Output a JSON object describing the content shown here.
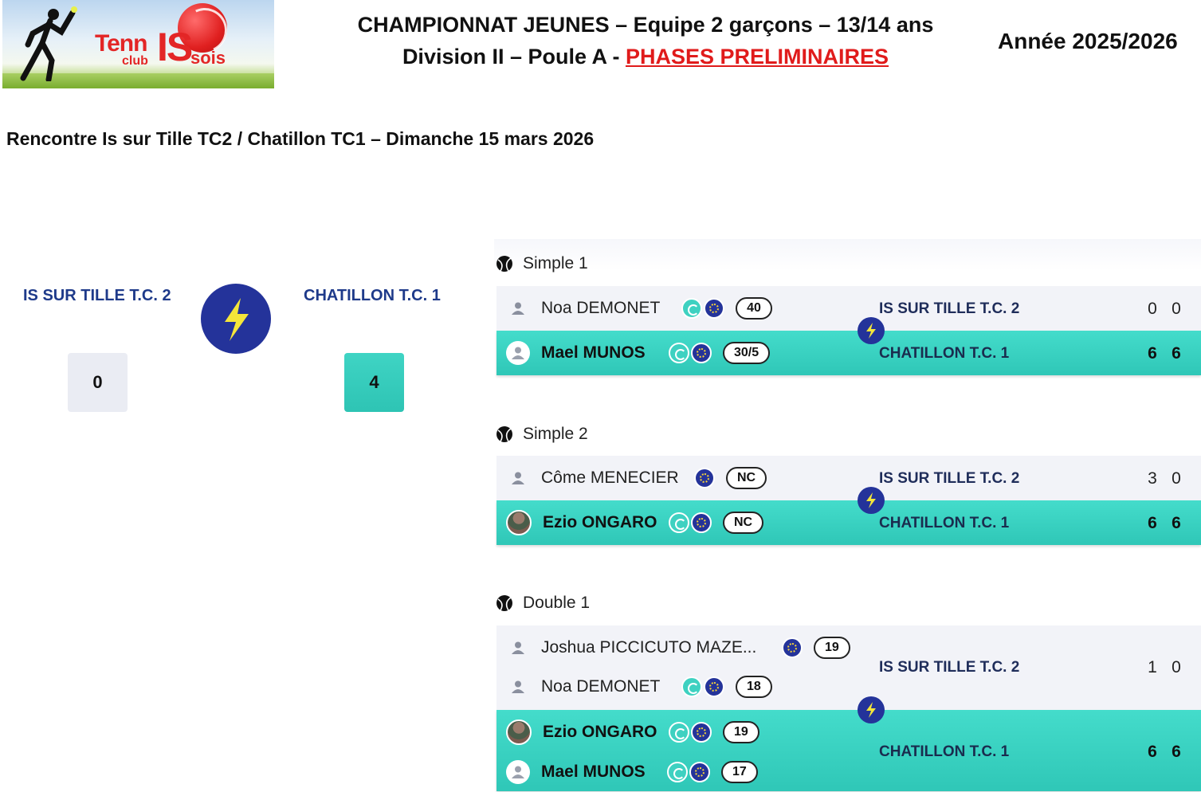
{
  "header": {
    "logo": {
      "word_tenn": "Tenn",
      "word_is": "IS",
      "word_club": "club",
      "word_sois": "sois"
    },
    "title_line1": "CHAMPIONNAT JEUNES – Equipe 2 garçons – 13/14 ans",
    "title_line2_prefix": "Division II – Poule A - ",
    "title_line2_highlight": "PHASES PRELIMINAIRES",
    "season": "Année 2025/2026",
    "rencontre": "Rencontre Is sur Tille TC2 / Chatillon TC1 – Dimanche 15 mars 2026"
  },
  "summary": {
    "home_team": "IS SUR TILLE T.C. 2",
    "away_team": "CHATILLON T.C. 1",
    "home_score": "0",
    "away_score": "4"
  },
  "matches": [
    {
      "title": "Simple 1",
      "home_team": "IS SUR TILLE T.C. 2",
      "away_team": "CHATILLON T.C. 1",
      "home_players": [
        {
          "name": "Noa DEMONET",
          "rank": "40"
        }
      ],
      "away_players": [
        {
          "name": "Mael MUNOS",
          "rank": "30/5"
        }
      ],
      "home_sets": [
        "0",
        "0"
      ],
      "away_sets": [
        "6",
        "6"
      ]
    },
    {
      "title": "Simple 2",
      "home_team": "IS SUR TILLE T.C. 2",
      "away_team": "CHATILLON T.C. 1",
      "home_players": [
        {
          "name": "Côme MENECIER",
          "rank": "NC"
        }
      ],
      "away_players": [
        {
          "name": "Ezio ONGARO",
          "rank": "NC"
        }
      ],
      "home_sets": [
        "3",
        "0"
      ],
      "away_sets": [
        "6",
        "6"
      ]
    },
    {
      "title": "Double 1",
      "home_team": "IS SUR TILLE T.C. 2",
      "away_team": "CHATILLON T.C. 1",
      "home_players": [
        {
          "name": "Joshua PICCICUTO MAZE...",
          "rank": "19"
        },
        {
          "name": "Noa DEMONET",
          "rank": "18"
        }
      ],
      "away_players": [
        {
          "name": "Ezio ONGARO",
          "rank": "19"
        },
        {
          "name": "Mael MUNOS",
          "rank": "17"
        }
      ],
      "home_sets": [
        "1",
        "0"
      ],
      "away_sets": [
        "6",
        "6"
      ]
    }
  ],
  "colors": {
    "navy": "#24339a",
    "teal": "#2fc7b7",
    "red": "#e01b1b",
    "bolt_yellow": "#f5e63a"
  }
}
